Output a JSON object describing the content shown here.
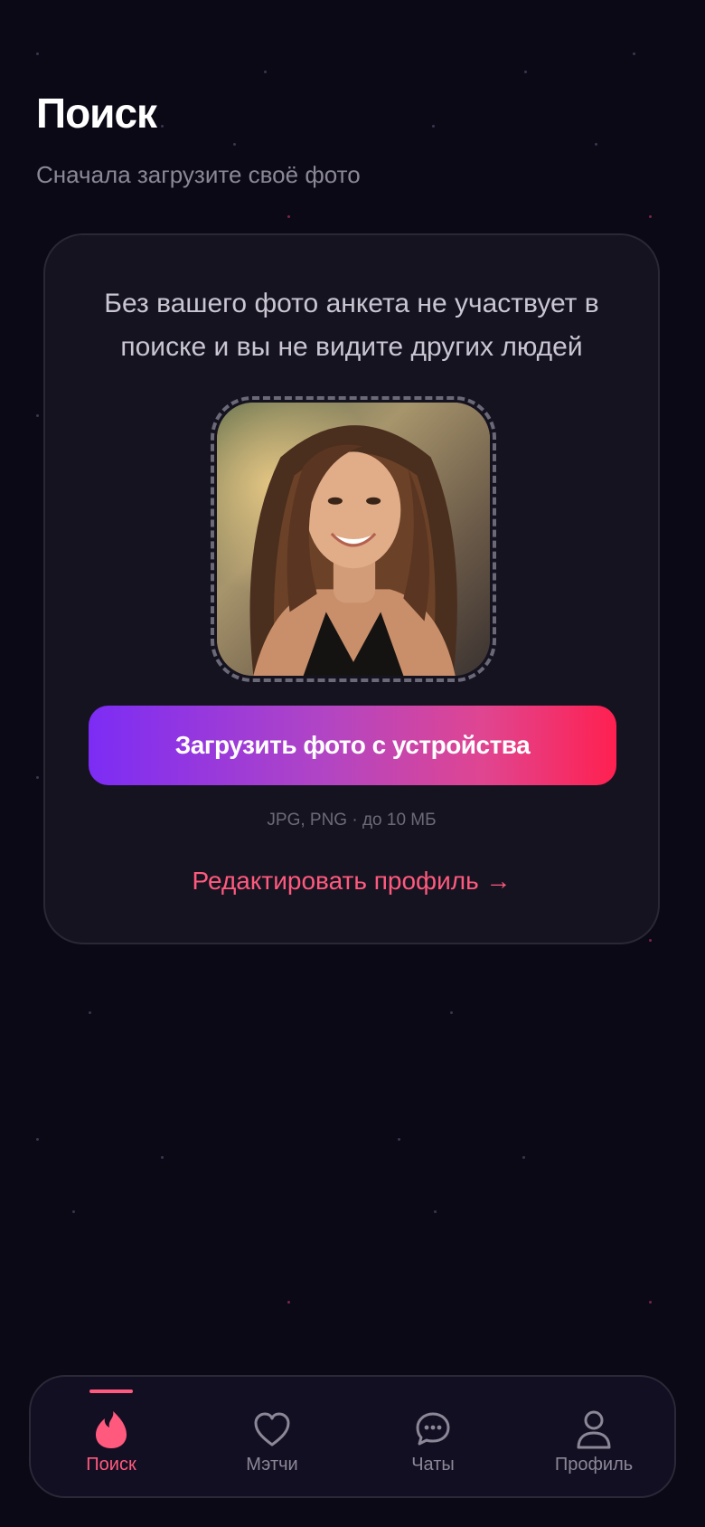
{
  "header": {
    "title": "Поиск",
    "subtitle": "Сначала загрузите своё фото"
  },
  "card": {
    "message": "Без вашего фото анкета не участвует в поиске и вы не видите других людей",
    "photo_alt": "example profile photo",
    "upload_button_label": "Загрузить фото с устройства",
    "formats_hint": "JPG, PNG · до 10 МБ",
    "edit_profile_link": "Редактировать профиль →"
  },
  "tabbar": {
    "active_tab": "search",
    "tabs": [
      {
        "id": "search",
        "label": "Поиск",
        "icon": "flame-icon"
      },
      {
        "id": "matches",
        "label": "Мэтчи",
        "icon": "heart-icon"
      },
      {
        "id": "chats",
        "label": "Чаты",
        "icon": "chat-bubble-icon"
      },
      {
        "id": "profile",
        "label": "Профиль",
        "icon": "person-icon"
      }
    ]
  },
  "colors": {
    "background": "#0b0916",
    "card_background": "#161320",
    "accent": "#ff5a7e",
    "button_gradient_start": "#7c2cf5",
    "button_gradient_end": "#ff2050",
    "muted_text": "#8b8797"
  }
}
